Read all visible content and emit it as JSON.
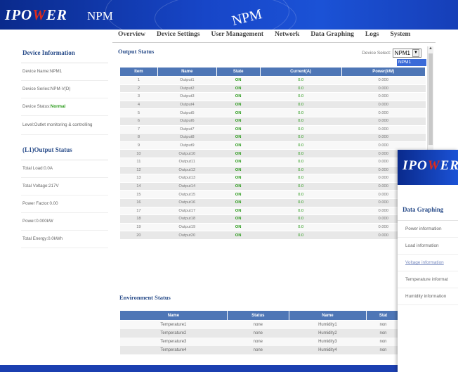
{
  "header": {
    "logo": "IPOWER",
    "logo_highlight": "W",
    "model_left": "NPM",
    "model_right": "NPM"
  },
  "nav": [
    "Overview",
    "Device Settings",
    "User Management",
    "Network",
    "Data Graphing",
    "Logs",
    "System"
  ],
  "device_info": {
    "title": "Device Information",
    "rows": [
      {
        "text": "Device Name:NPM1"
      },
      {
        "text": "Device Series:NPM-V(D)"
      },
      {
        "prefix": "Device Status:",
        "status": "Normal"
      },
      {
        "text": "Level:Outlet monitoring & controlling"
      }
    ]
  },
  "output_status_side": {
    "title": "(L1)Output Status",
    "rows": [
      "Total Load:0.0A",
      "Total Voltage:217V",
      "Power Factor:0.00",
      "Power:0.000kW",
      "Total Energy:0.0kWh"
    ]
  },
  "output_status": {
    "title": "Output Status",
    "device_select_label": "Device Select:",
    "device_select_value": "NPM1",
    "device_option": "NPM1",
    "columns": [
      "Item",
      "Name",
      "State",
      "Current(A)",
      "Power(kW)"
    ],
    "rows": [
      [
        "1",
        "Output1",
        "ON",
        "0.0",
        "0.000"
      ],
      [
        "2",
        "Output2",
        "ON",
        "0.0",
        "0.000"
      ],
      [
        "3",
        "Output3",
        "ON",
        "0.0",
        "0.000"
      ],
      [
        "4",
        "Output4",
        "ON",
        "0.0",
        "0.000"
      ],
      [
        "5",
        "Output5",
        "ON",
        "0.0",
        "0.000"
      ],
      [
        "6",
        "Output6",
        "ON",
        "0.0",
        "0.000"
      ],
      [
        "7",
        "Output7",
        "ON",
        "0.0",
        "0.000"
      ],
      [
        "8",
        "Output8",
        "ON",
        "0.0",
        "0.000"
      ],
      [
        "9",
        "Output9",
        "ON",
        "0.0",
        "0.000"
      ],
      [
        "10",
        "Output10",
        "ON",
        "0.0",
        "0.000"
      ],
      [
        "11",
        "Output11",
        "ON",
        "0.0",
        "0.000"
      ],
      [
        "12",
        "Output12",
        "ON",
        "0.0",
        "0.000"
      ],
      [
        "13",
        "Output13",
        "ON",
        "0.0",
        "0.000"
      ],
      [
        "14",
        "Output14",
        "ON",
        "0.0",
        "0.000"
      ],
      [
        "15",
        "Output15",
        "ON",
        "0.0",
        "0.000"
      ],
      [
        "16",
        "Output16",
        "ON",
        "0.0",
        "0.000"
      ],
      [
        "17",
        "Output17",
        "ON",
        "0.0",
        "0.000"
      ],
      [
        "18",
        "Output18",
        "ON",
        "0.0",
        "0.000"
      ],
      [
        "19",
        "Output19",
        "ON",
        "0.0",
        "0.000"
      ],
      [
        "20",
        "Output20",
        "ON",
        "0.0",
        "0.000"
      ]
    ]
  },
  "environment_status": {
    "title": "Environment Status",
    "columns": [
      "Name",
      "Status",
      "Name",
      "Stat"
    ],
    "rows": [
      [
        "Temperature1",
        "none",
        "Humidity1",
        "non"
      ],
      [
        "Temperature2",
        "none",
        "Humidity2",
        "non"
      ],
      [
        "Temperature3",
        "none",
        "Humidity3",
        "non"
      ],
      [
        "Temperature4",
        "none",
        "Humidity4",
        "non"
      ]
    ]
  },
  "data_graphing_overlay": {
    "logo": "IPOWER",
    "title": "Data Graphing",
    "items": [
      "Power information",
      "Load information",
      "Voltage information",
      "Temperature informat",
      "Humidity information"
    ],
    "active_index": 2
  }
}
